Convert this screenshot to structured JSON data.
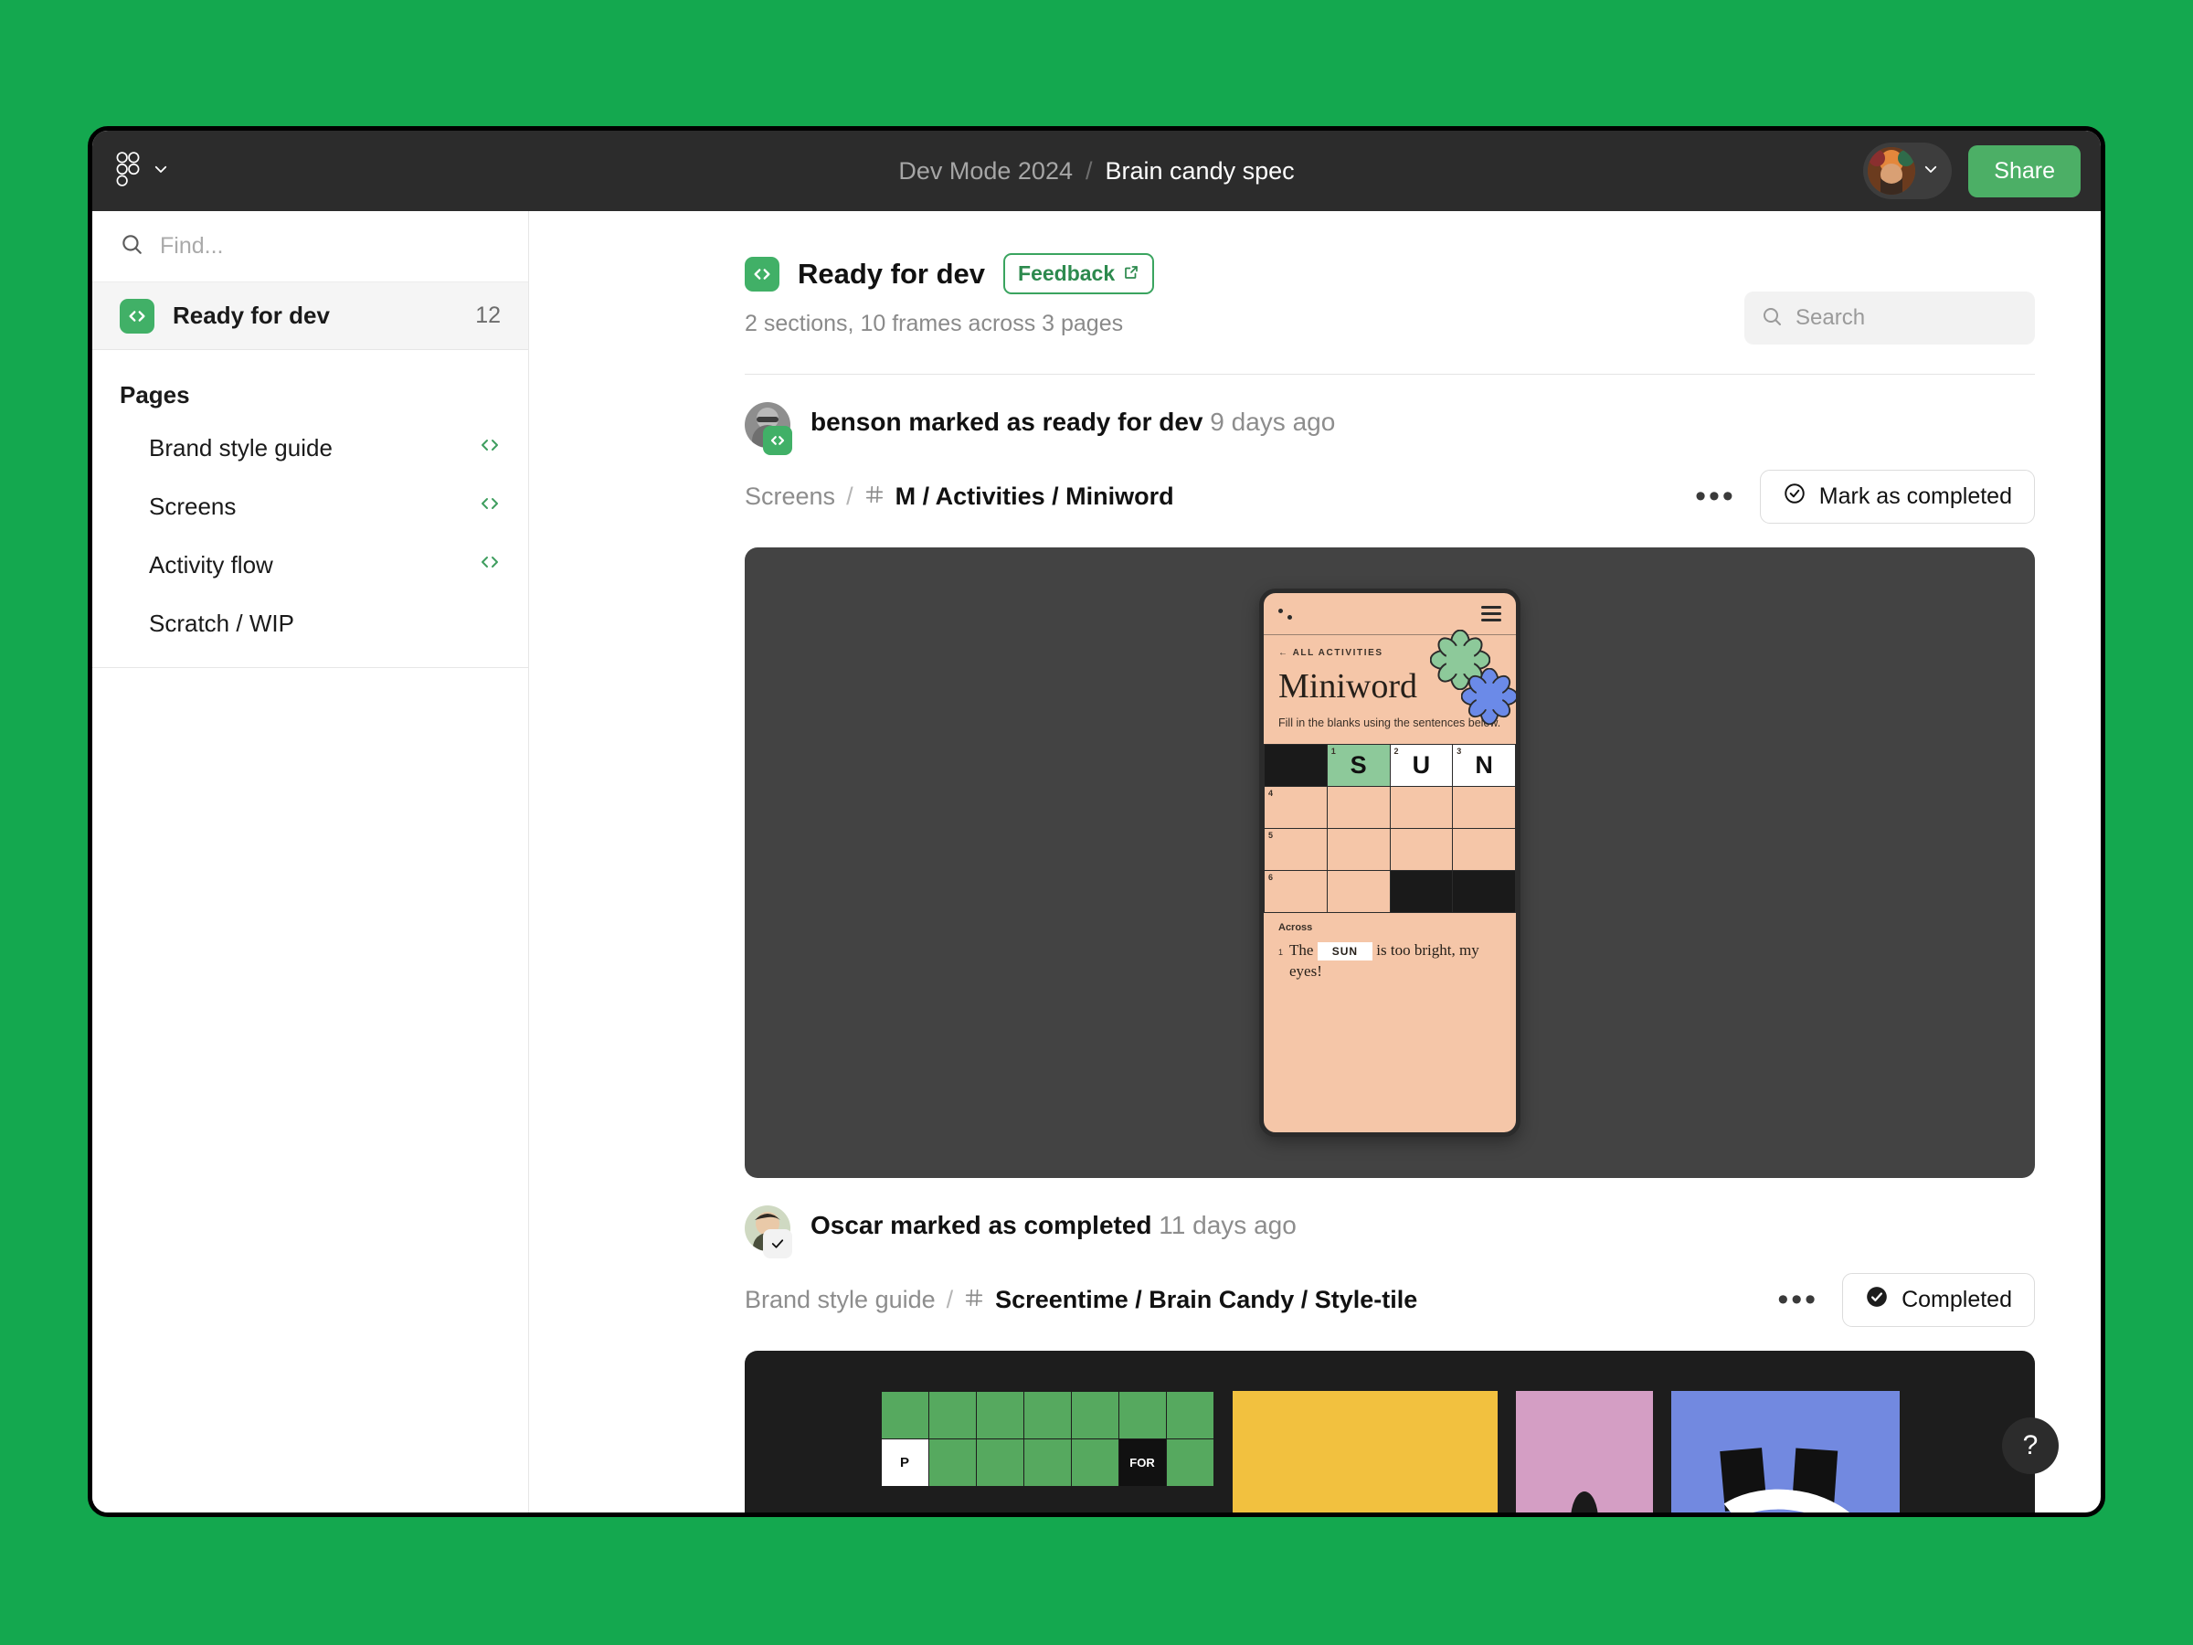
{
  "topbar": {
    "logo_icon": "figma-logo-icon",
    "menu_chevron_icon": "chevron-down-icon",
    "breadcrumb_project": "Dev Mode 2024",
    "breadcrumb_separator": "/",
    "breadcrumb_file": "Brain candy spec",
    "account_chevron_icon": "chevron-down-icon",
    "share_label": "Share"
  },
  "sidebar": {
    "find_placeholder": "Find...",
    "find_value": "",
    "search_icon": "search-icon",
    "ready_for_dev": {
      "label": "Ready for dev",
      "count": "12",
      "icon": "code-brackets-icon"
    },
    "pages_header": "Pages",
    "pages": [
      {
        "label": "Brand style guide",
        "has_code_icon": true,
        "code_icon": "code-brackets-icon"
      },
      {
        "label": "Screens",
        "has_code_icon": true,
        "code_icon": "code-brackets-icon"
      },
      {
        "label": "Activity flow",
        "has_code_icon": true,
        "code_icon": "code-brackets-icon"
      },
      {
        "label": "Scratch / WIP",
        "has_code_icon": false,
        "code_icon": ""
      }
    ]
  },
  "main": {
    "section_icon": "code-brackets-icon",
    "section_title": "Ready for dev",
    "feedback_label": "Feedback",
    "feedback_icon": "external-link-icon",
    "section_subtitle": "2 sections, 10 frames across 3 pages",
    "search_placeholder": "Search",
    "search_value": "",
    "search_icon": "search-icon"
  },
  "activities": [
    {
      "actor": "benson",
      "action_text": "benson marked as ready for dev",
      "time": "9 days ago",
      "badge_icon": "code-brackets-icon",
      "path_page": "Screens",
      "path_sep": "/",
      "frame_icon": "frame-hash-icon",
      "path_frame": "M / Activities / Miniword",
      "overflow_icon": "more-horizontal-icon",
      "overflow_label": "•••",
      "action_button": {
        "label": "Mark as completed",
        "icon": "check-circle-outline-icon"
      }
    },
    {
      "actor": "Oscar",
      "action_text": "Oscar marked as completed",
      "time": "11 days ago",
      "badge_icon": "check-icon",
      "path_page": "Brand style guide",
      "path_sep": "/",
      "frame_icon": "frame-hash-icon",
      "path_frame": "Screentime / Brain Candy / Style-tile",
      "overflow_icon": "more-horizontal-icon",
      "overflow_label": "•••",
      "action_button": {
        "label": "Completed",
        "icon": "check-circle-filled-icon"
      }
    }
  ],
  "miniword_preview": {
    "status_dots_icon": "status-dots-icon",
    "menu_icon": "hamburger-menu-icon",
    "back_label": "← ALL ACTIVITIES",
    "title": "Miniword",
    "description": "Fill in the blanks using the sentences below.",
    "flower_green_icon": "flower-green-icon",
    "flower_blue_icon": "flower-blue-icon",
    "grid": [
      [
        {
          "type": "black",
          "num": "",
          "letter": ""
        },
        {
          "type": "green",
          "num": "1",
          "letter": "S"
        },
        {
          "type": "white",
          "num": "2",
          "letter": "U"
        },
        {
          "type": "white",
          "num": "3",
          "letter": "N"
        }
      ],
      [
        {
          "type": "peach",
          "num": "4",
          "letter": ""
        },
        {
          "type": "peach",
          "num": "",
          "letter": ""
        },
        {
          "type": "peach",
          "num": "",
          "letter": ""
        },
        {
          "type": "peach",
          "num": "",
          "letter": ""
        }
      ],
      [
        {
          "type": "peach",
          "num": "5",
          "letter": ""
        },
        {
          "type": "peach",
          "num": "",
          "letter": ""
        },
        {
          "type": "peach",
          "num": "",
          "letter": ""
        },
        {
          "type": "peach",
          "num": "",
          "letter": ""
        }
      ],
      [
        {
          "type": "peach",
          "num": "6",
          "letter": ""
        },
        {
          "type": "peach",
          "num": "",
          "letter": ""
        },
        {
          "type": "black",
          "num": "",
          "letter": ""
        },
        {
          "type": "black",
          "num": "",
          "letter": ""
        }
      ]
    ],
    "clues_header": "Across",
    "clue_number": "1",
    "clue_before": "The",
    "clue_answer": "SUN",
    "clue_after": "is too bright, my eyes!"
  },
  "styletile_preview": {
    "grid_letters": [
      "P",
      "FOR"
    ],
    "swatch_green": "#56a95f",
    "swatch_yellow": "#f2c13f",
    "swatch_pink": "#d49ec4",
    "swatch_blue": "#7289e0"
  },
  "help": {
    "label": "?",
    "icon": "question-mark-icon"
  },
  "colors": {
    "page_background": "#14a84f",
    "topbar": "#2c2c2c",
    "accent_green": "#4caf66",
    "badge_green": "#41b067",
    "preview_dark": "#434343",
    "tile_dark": "#1d1d1d"
  }
}
